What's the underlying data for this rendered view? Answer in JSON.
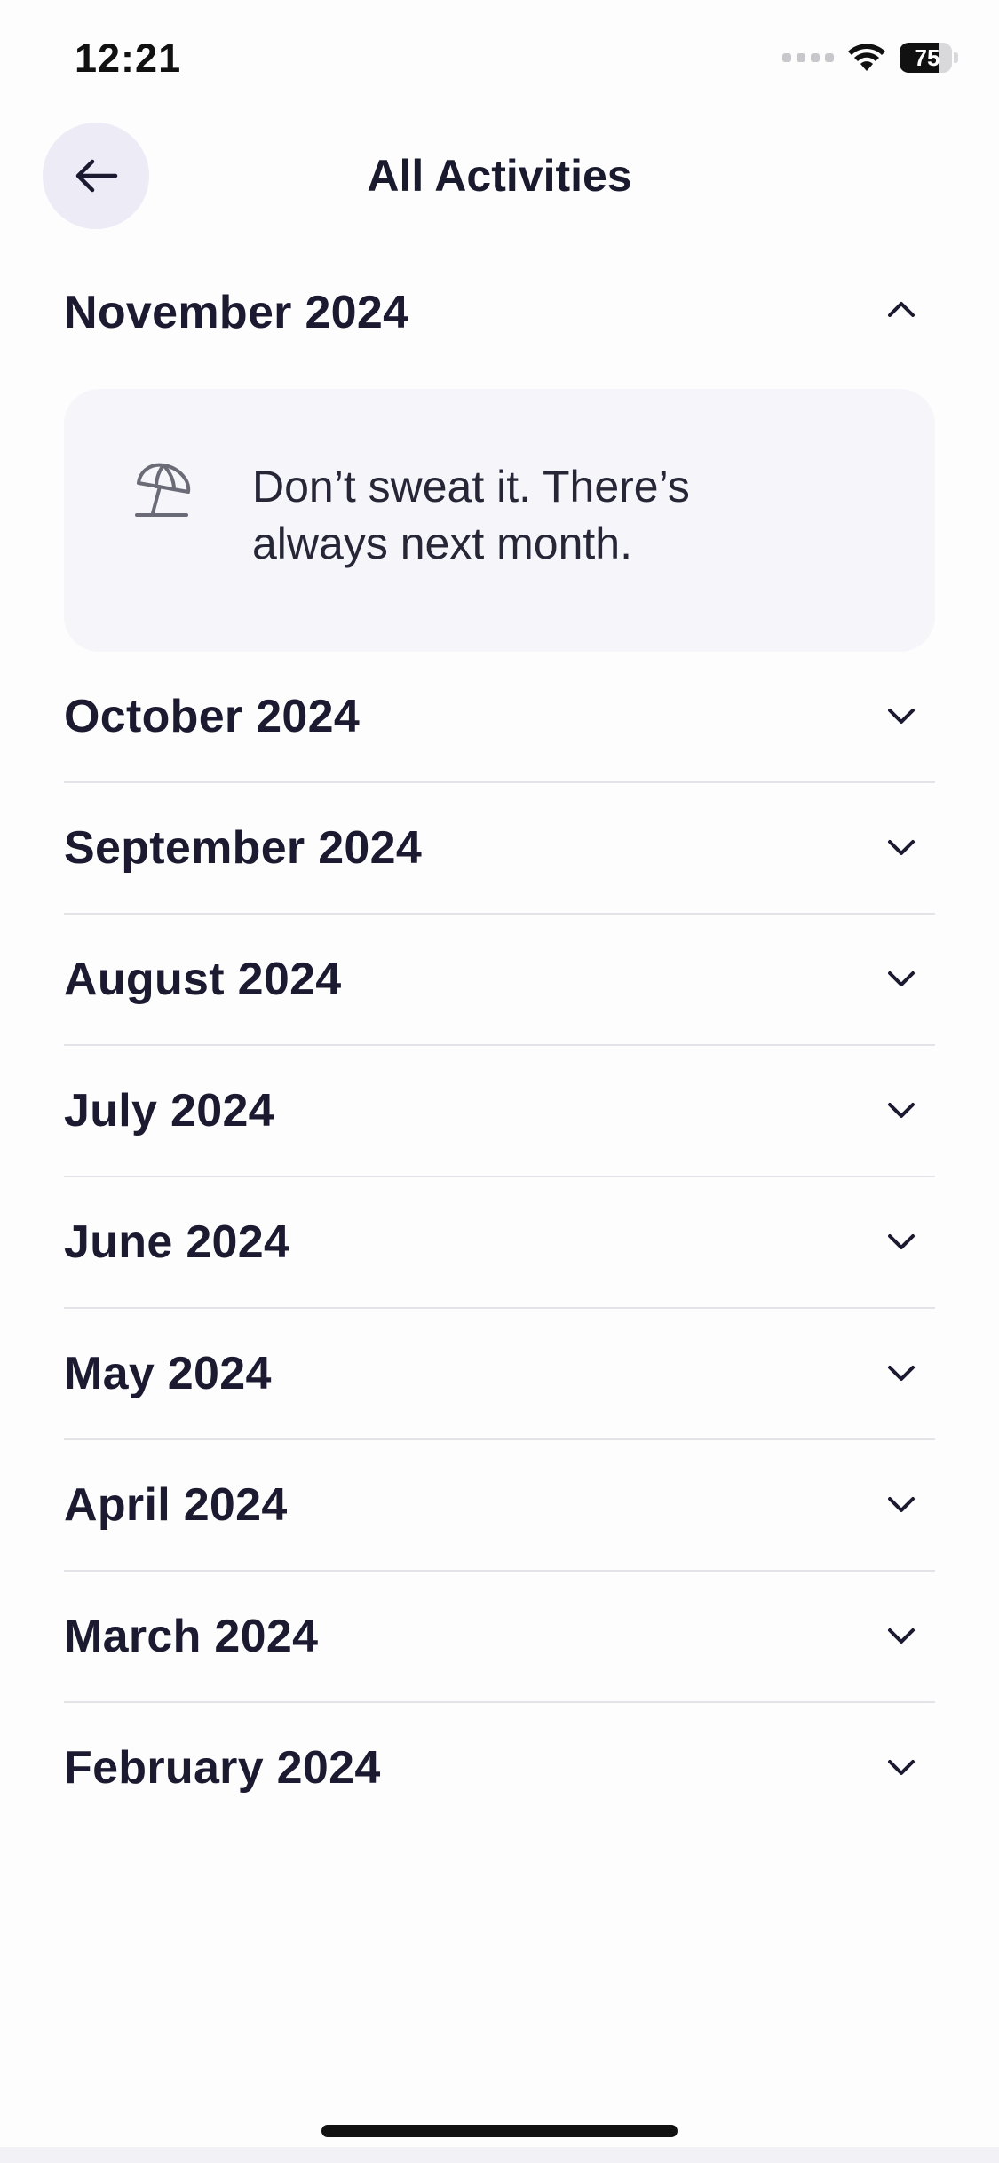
{
  "status_bar": {
    "time": "12:21",
    "battery_level": "75",
    "battery_fraction": 0.75,
    "icons": [
      "signal-dots-icon",
      "wifi-icon",
      "battery-icon"
    ]
  },
  "header": {
    "title": "All Activities",
    "back_icon": "arrow-left-icon"
  },
  "months": [
    {
      "label": "November 2024",
      "expanded": true
    },
    {
      "label": "October 2024",
      "expanded": false
    },
    {
      "label": "September 2024",
      "expanded": false
    },
    {
      "label": "August 2024",
      "expanded": false
    },
    {
      "label": "July 2024",
      "expanded": false
    },
    {
      "label": "June 2024",
      "expanded": false
    },
    {
      "label": "May 2024",
      "expanded": false
    },
    {
      "label": "April 2024",
      "expanded": false
    },
    {
      "label": "March 2024",
      "expanded": false
    },
    {
      "label": "February 2024",
      "expanded": false
    }
  ],
  "empty_state": {
    "icon": "beach-umbrella-icon",
    "line1": "Don’t sweat it. There’s",
    "line2": "always next month."
  },
  "colors": {
    "background": "#fdfdfe",
    "back_button_bg": "#ecebf6",
    "card_bg": "#f5f5fa",
    "text_primary": "#1b1a30",
    "divider": "#e4e4e8"
  }
}
